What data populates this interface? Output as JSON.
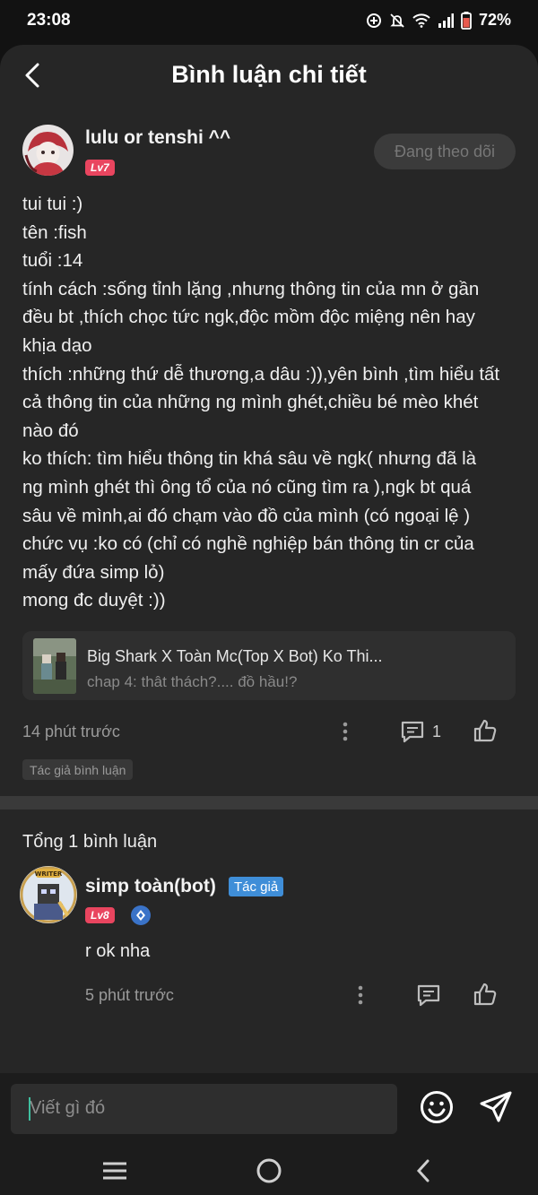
{
  "status": {
    "time": "23:08",
    "battery": "72%"
  },
  "header": {
    "title": "Bình luận chi tiết"
  },
  "post": {
    "author": "lulu or tenshi ^^",
    "level": "Lv7",
    "follow_label": "Đang theo dõi",
    "lines": [
      "tui tui :)",
      "tên :fish",
      "tuổi :14",
      "tính cách :sống tỉnh lặng ,nhưng thông tin của mn ở gần",
      "đều bt ,thích chọc tức ngk,độc mồm độc miệng nên hay",
      "khịa dạo",
      "thích :những thứ dễ thương,a dâu :)),yên bình ,tìm hiểu tất",
      "cả thông tin của những ng mình ghét,chiều bé mèo khét",
      "nào đó",
      "ko thích: tìm hiểu thông tin khá sâu về ngk( nhưng đã là",
      "ng mình ghét thì ông tổ của nó cũng tìm ra ),ngk bt quá",
      "sâu về mình,ai đó chạm vào đồ của mình (có ngoại lệ )",
      "chức vụ :ko có (chỉ có nghề nghiệp bán thông tin cr của",
      "mấy đứa simp lỏ)",
      "mong đc duyệt :))"
    ],
    "story_title": "Big Shark X Toàn Mc(Top X Bot) Ko Thi...",
    "story_chapter": "chap 4: thât thách?.... đồ hầu!?",
    "time": "14 phút trước",
    "reply_count": "1",
    "author_tag": "Tác giả bình luận"
  },
  "comments": {
    "total": "Tổng 1 bình luận",
    "items": [
      {
        "name": "simp toàn(bot)",
        "author_label": "Tác giả",
        "level": "Lv8",
        "text": "r ok nha",
        "time": "5 phút trước"
      }
    ]
  },
  "input": {
    "placeholder": "Viết gì đó"
  },
  "colors": {
    "background": "#262626",
    "level_badge": "#e9455f",
    "author_label": "#3f8ed8",
    "caret": "#3fbf9f"
  },
  "icons": [
    "back-arrow-icon",
    "more-vertical-icon",
    "comment-icon",
    "like-icon",
    "emoji-icon",
    "send-icon",
    "menu-icon",
    "home-circle-icon",
    "nav-back-icon",
    "wifi-icon",
    "signal-icon",
    "battery-icon",
    "mute-icon",
    "data-saver-icon"
  ]
}
